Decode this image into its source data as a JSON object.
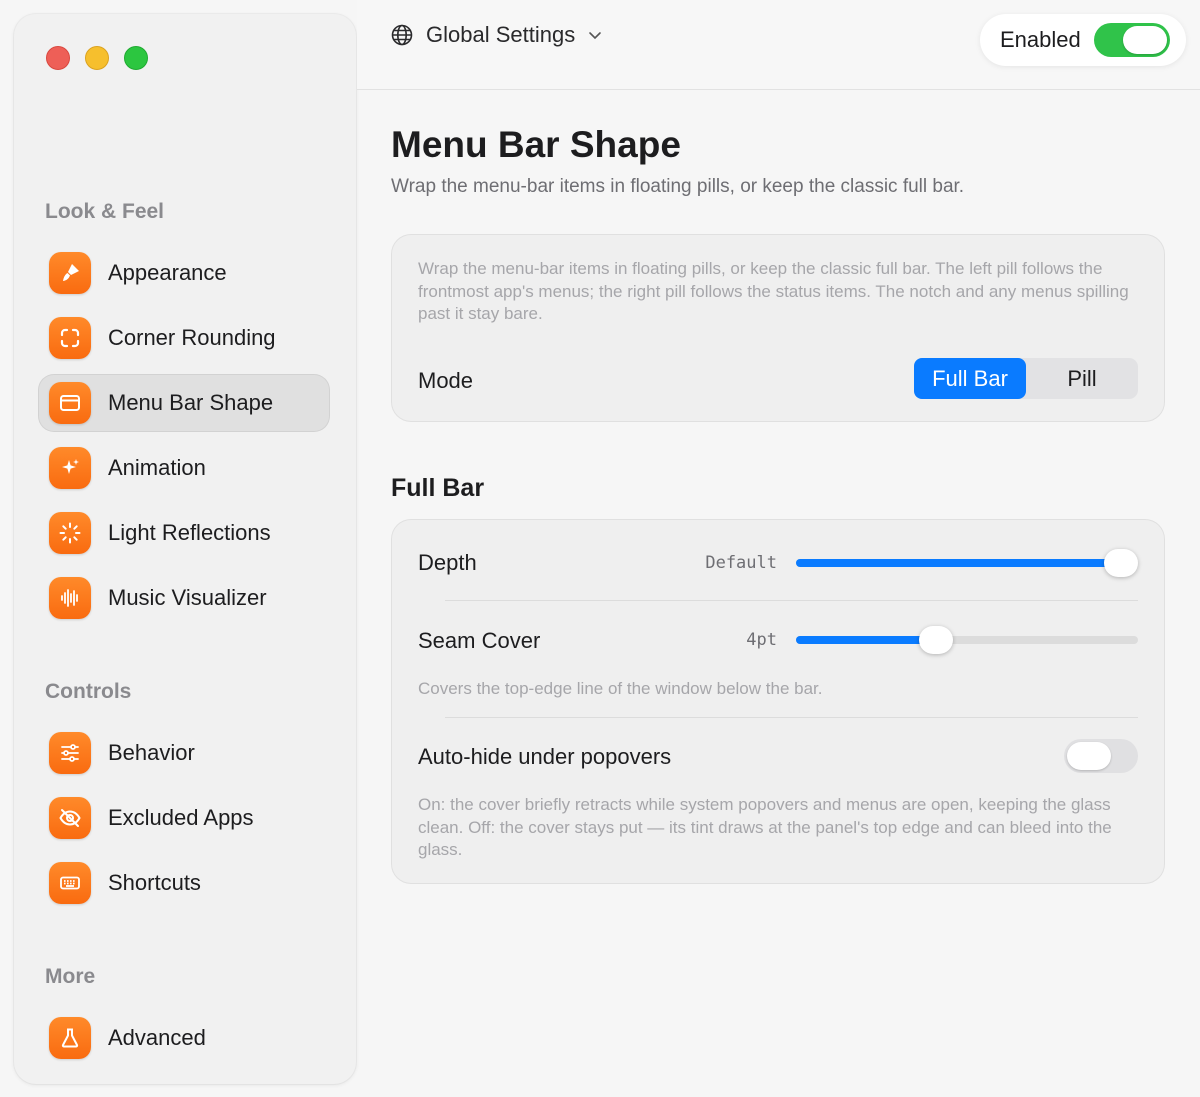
{
  "sidebar": {
    "sections": [
      {
        "title": "Look & Feel",
        "items": [
          {
            "label": "Appearance",
            "icon": "paintbrush-icon"
          },
          {
            "label": "Corner Rounding",
            "icon": "corners-icon"
          },
          {
            "label": "Menu Bar Shape",
            "icon": "menubar-icon",
            "selected": true
          },
          {
            "label": "Animation",
            "icon": "sparkles-icon"
          },
          {
            "label": "Light Reflections",
            "icon": "light-burst-icon"
          },
          {
            "label": "Music Visualizer",
            "icon": "waveform-icon"
          }
        ]
      },
      {
        "title": "Controls",
        "items": [
          {
            "label": "Behavior",
            "icon": "sliders-icon"
          },
          {
            "label": "Excluded Apps",
            "icon": "eye-slash-icon"
          },
          {
            "label": "Shortcuts",
            "icon": "keyboard-icon"
          }
        ]
      },
      {
        "title": "More",
        "items": [
          {
            "label": "Advanced",
            "icon": "flask-icon"
          }
        ]
      }
    ]
  },
  "header": {
    "scope_label": "Global Settings",
    "enabled_label": "Enabled",
    "enabled": true
  },
  "page": {
    "title": "Menu Bar Shape",
    "subtitle": "Wrap the menu-bar items in floating pills, or keep the classic full bar."
  },
  "mode_card": {
    "description": "Wrap the menu-bar items in floating pills, or keep the classic full bar. The left pill follows the frontmost app's menus; the right pill follows the status items. The notch and any menus spilling past it stay bare.",
    "mode_label": "Mode",
    "options": [
      "Full Bar",
      "Pill"
    ],
    "selected": "Full Bar"
  },
  "full_bar": {
    "title": "Full Bar",
    "depth": {
      "label": "Depth",
      "value": "Default",
      "fraction": 0.95
    },
    "seam_cover": {
      "label": "Seam Cover",
      "value": "4pt",
      "fraction": 0.41,
      "hint": "Covers the top-edge line of the window below the bar."
    },
    "auto_hide": {
      "label": "Auto-hide under popovers",
      "enabled": false,
      "hint": "On: the cover briefly retracts while system popovers and menus are open, keeping the glass clean. Off: the cover stays put — its tint draws at the panel's top edge and can bleed into the glass."
    }
  },
  "colors": {
    "accent": "#0a7bff",
    "icon_orange": "#f96b10",
    "toggle_green": "#30c34a"
  }
}
